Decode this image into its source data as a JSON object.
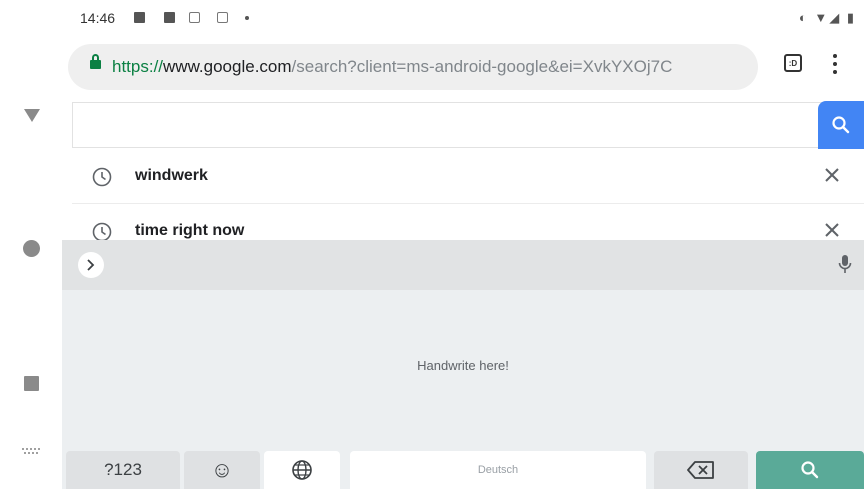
{
  "status_bar": {
    "time": "14:46",
    "right_indicators": "◐ ▼◢ ▮"
  },
  "url_bar": {
    "scheme": "https://",
    "host": "www.google.com",
    "rest": "/search?client=ms-android-google&ei=XvkYXOj7C",
    "tab_switcher_label": ":D"
  },
  "search": {
    "query": "",
    "button_color": "#4285f4"
  },
  "suggestions": [
    {
      "text": "windwerk",
      "icon": "history-clock-icon"
    },
    {
      "text": "time right now",
      "icon": "history-clock-icon"
    }
  ],
  "keyboard": {
    "handwrite_prompt": "Handwrite here!",
    "keys": {
      "symbols": "?123",
      "emoji": "☺",
      "space_label": "Deutsch"
    },
    "action_color": "#5aaa98"
  },
  "colors": {
    "secure_green": "#0b8043",
    "brand_blue": "#4285f4"
  }
}
